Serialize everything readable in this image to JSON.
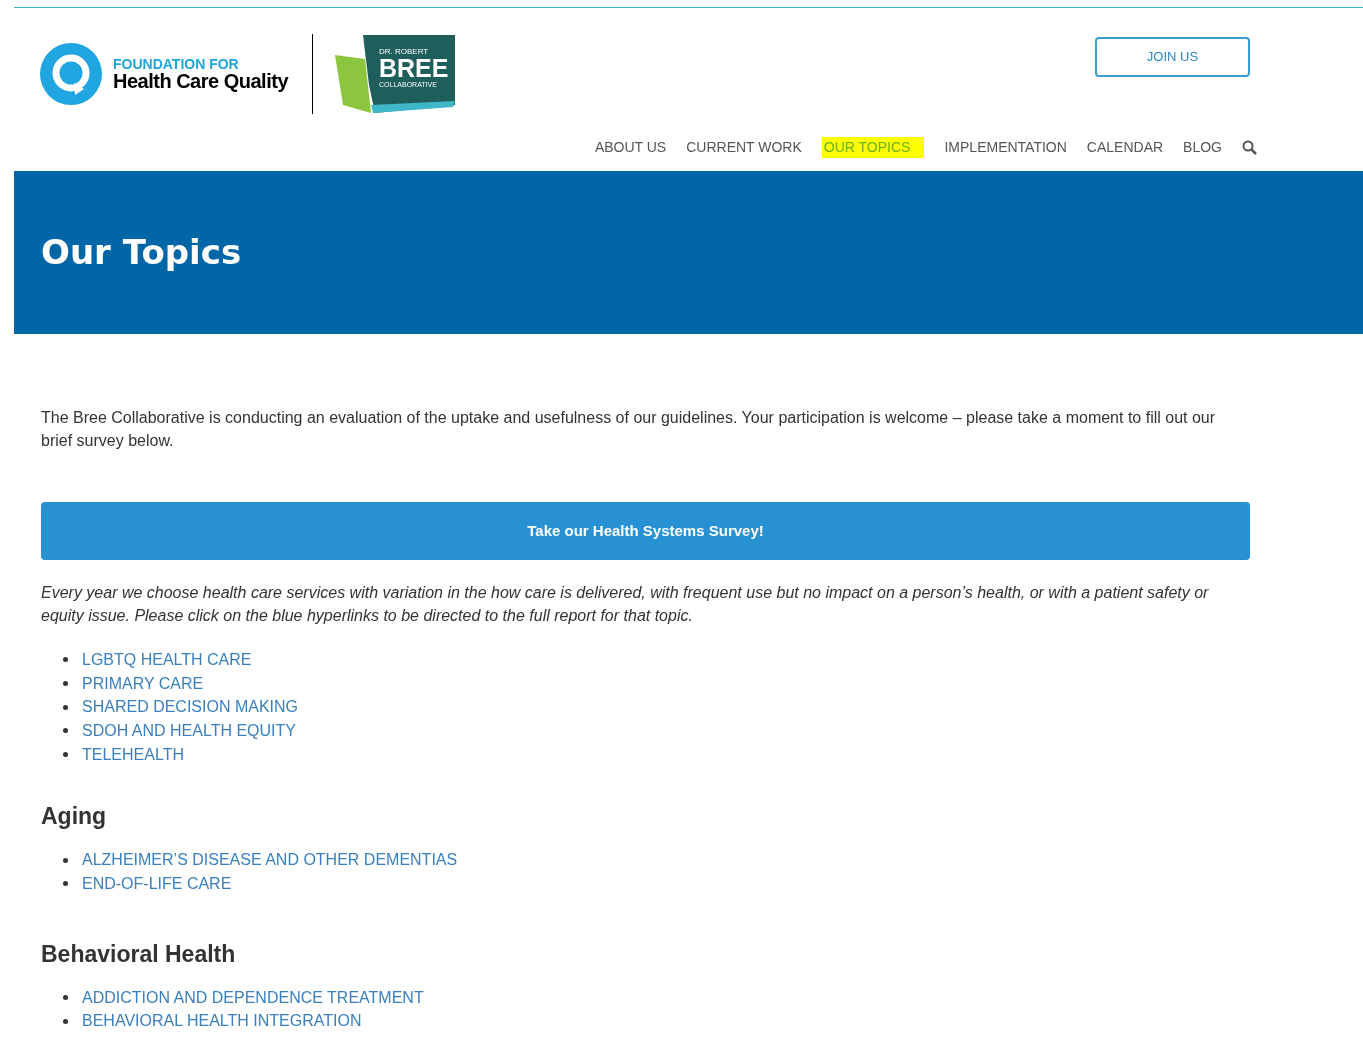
{
  "logo": {
    "line_1": "FOUNDATION FOR",
    "line_2": "Health Care Quality"
  },
  "partner_logo": {
    "line_1": "DR. ROBERT",
    "line_2": "BREE",
    "line_3": "COLLABORATIVE"
  },
  "join_button": "JOIN US",
  "nav": [
    {
      "label": "ABOUT US",
      "selected": false
    },
    {
      "label": "CURRENT WORK",
      "selected": false
    },
    {
      "label": "OUR TOPICS",
      "selected": true
    },
    {
      "label": "IMPLEMENTATION",
      "selected": false
    },
    {
      "label": "CALENDAR",
      "selected": false
    },
    {
      "label": "BLOG",
      "selected": false
    }
  ],
  "banner_title": "Our Topics",
  "intro": "The Bree Collaborative is conducting an evaluation of the uptake and usefulness of our guidelines. Your participation is welcome – please take a moment to fill out our brief survey below.",
  "survey_button": "Take our Health Systems Survey!",
  "note": "Every year we choose health care services with variation in the how care is delivered, with frequent use but no impact on a person’s health, or with a patient safety or equity issue. Please click on the blue hyperlinks to be directed to the full report for that topic.",
  "sections": [
    {
      "links": [
        "LGBTQ HEALTH CARE",
        "PRIMARY CARE",
        "SHARED DECISION MAKING",
        "SDOH AND HEALTH EQUITY",
        "TELEHEALTH"
      ]
    },
    {
      "heading": "Aging",
      "links": [
        "ALZHEIMER’S DISEASE AND OTHER DEMENTIAS",
        "END-OF-LIFE CARE"
      ]
    },
    {
      "heading": "Behavioral Health",
      "links": [
        "ADDICTION AND DEPENDENCE TREATMENT",
        "BEHAVIORAL HEALTH INTEGRATION"
      ]
    }
  ]
}
